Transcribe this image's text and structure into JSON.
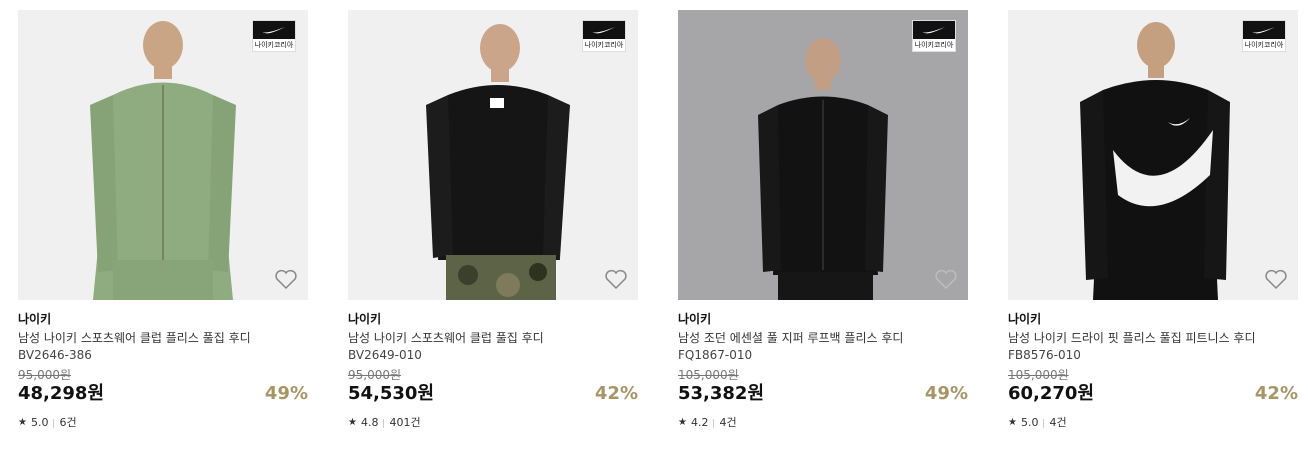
{
  "products": [
    {
      "badge_text": "나이키코리아",
      "brand": "나이키",
      "name": "남성 나이키 스포츠웨어 클럽 플리스 풀집 후디",
      "code": "BV2646-386",
      "original_price": "95,000원",
      "price": "48,298원",
      "discount": "49%",
      "rating": "5.0",
      "reviews": "6건",
      "colors": {
        "background": "#f0f0f0",
        "garment": "#8fac80"
      }
    },
    {
      "badge_text": "나이키코리아",
      "brand": "나이키",
      "name": "남성 나이키 스포츠웨어 클럽 풀집 후디",
      "code": "BV2649-010",
      "original_price": "95,000원",
      "price": "54,530원",
      "discount": "42%",
      "rating": "4.8",
      "reviews": "401건",
      "colors": {
        "background": "#f0f0f0",
        "garment": "#151515"
      }
    },
    {
      "badge_text": "나이키코리아",
      "brand": "나이키",
      "name": "남성 조던 에센셜 풀 지퍼 루프백 플리스 후디",
      "code": "FQ1867-010",
      "original_price": "105,000원",
      "price": "53,382원",
      "discount": "49%",
      "rating": "4.2",
      "reviews": "4건",
      "colors": {
        "background": "#a6a6a8",
        "garment": "#121212"
      }
    },
    {
      "badge_text": "나이키코리아",
      "brand": "나이키",
      "name": "남성 나이키 드라이 핏 플리스 풀집 피트니스 후디",
      "code": "FB8576-010",
      "original_price": "105,000원",
      "price": "60,270원",
      "discount": "42%",
      "rating": "5.0",
      "reviews": "4건",
      "colors": {
        "background": "#f0f0f0",
        "garment": "#111111"
      }
    }
  ],
  "icons": {
    "badge": "nike-swoosh-icon",
    "wishlist": "heart-icon",
    "rating": "star-icon"
  },
  "accent_colors": {
    "discount": "#a69567"
  }
}
